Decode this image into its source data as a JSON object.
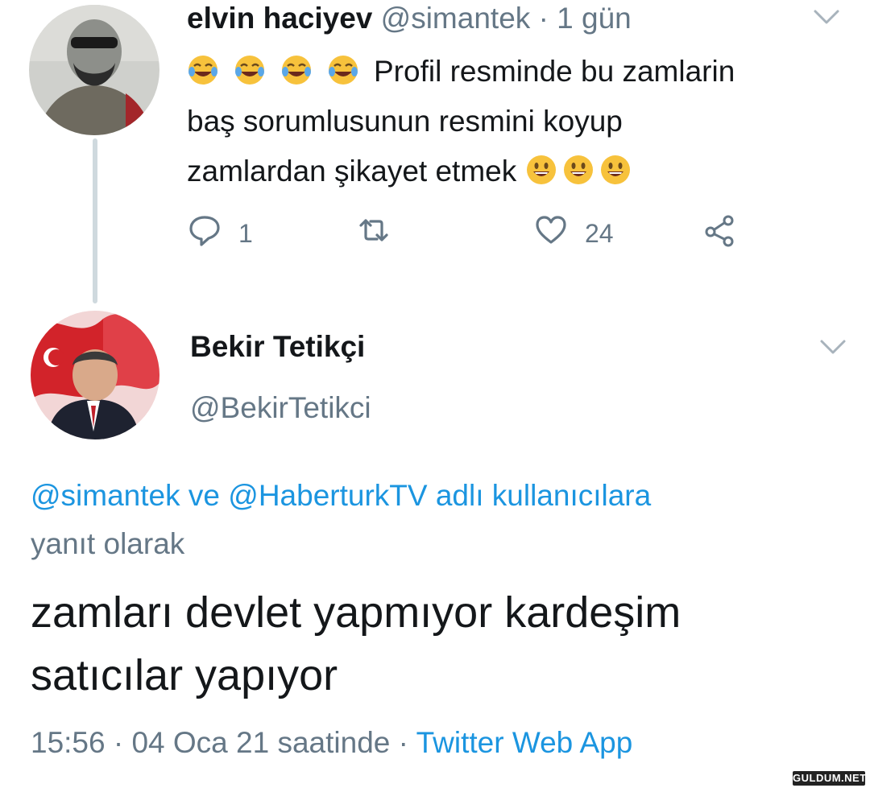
{
  "tweet": {
    "author_name": "elvin haciyev",
    "author_handle": "@simantek",
    "dot": "·",
    "time": "1 gün",
    "text_line1": "Profil resminde bu zamlarin",
    "text_line2": "baş sorumlusunun resmini koyup",
    "text_line3": "zamlardan şikayet etmek",
    "emojis_leading": [
      "face-with-tears-of-joy",
      "face-with-tears-of-joy",
      "face-with-tears-of-joy",
      "face-with-tears-of-joy"
    ],
    "emojis_trailing": [
      "grinning-face",
      "grinning-face",
      "grinning-face"
    ],
    "reply_count": "1",
    "like_count": "24"
  },
  "reply": {
    "author_name": "Bekir Tetikçi",
    "author_handle": "@BekirTetikci",
    "mention1": "@simantek",
    "connector": "ve",
    "mention2": "@HaberturkTV",
    "reply_suffix": "adlı kullanıcılara",
    "reply_suffix2": "yanıt olarak",
    "text_line1": "zamları devlet yapmıyor kardeşim",
    "text_line2": "satıcılar yapıyor",
    "timestamp": "15:56 · 04 Oca 21 saatinde ·",
    "source": "Twitter Web App"
  },
  "watermark": "GULDUM.NET",
  "colors": {
    "text": "#14171a",
    "secondary": "#657786",
    "link": "#1b95e0",
    "thread_line": "#cfd9de"
  }
}
